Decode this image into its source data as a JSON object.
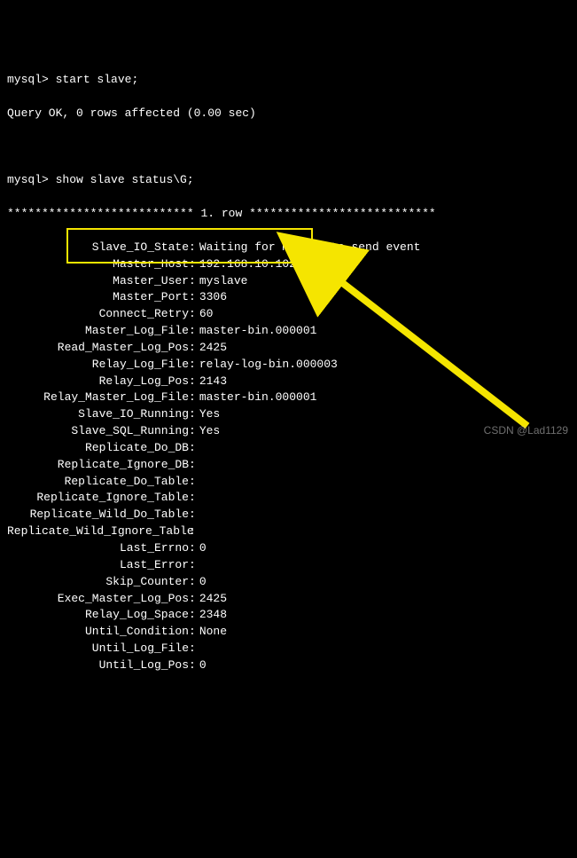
{
  "prompt": "mysql>",
  "cmd1": "start slave;",
  "resp1": "Query OK, 0 rows affected (0.00 sec)",
  "cmd2": "show slave status\\G;",
  "divider_left": "***************************",
  "divider_mid": " 1. row ",
  "divider_right": "***************************",
  "colon": ":",
  "fields": [
    {
      "label": "Slave_IO_State",
      "value": "Waiting for master to send event"
    },
    {
      "label": "Master_Host",
      "value": "192.168.10.102"
    },
    {
      "label": "Master_User",
      "value": "myslave"
    },
    {
      "label": "Master_Port",
      "value": "3306"
    },
    {
      "label": "Connect_Retry",
      "value": "60"
    },
    {
      "label": "Master_Log_File",
      "value": "master-bin.000001"
    },
    {
      "label": "Read_Master_Log_Pos",
      "value": "2425"
    },
    {
      "label": "Relay_Log_File",
      "value": "relay-log-bin.000003"
    },
    {
      "label": "Relay_Log_Pos",
      "value": "2143"
    },
    {
      "label": "Relay_Master_Log_File",
      "value": "master-bin.000001"
    },
    {
      "label": "Slave_IO_Running",
      "value": "Yes"
    },
    {
      "label": "Slave_SQL_Running",
      "value": "Yes"
    },
    {
      "label": "Replicate_Do_DB",
      "value": ""
    },
    {
      "label": "Replicate_Ignore_DB",
      "value": ""
    },
    {
      "label": "Replicate_Do_Table",
      "value": ""
    },
    {
      "label": "Replicate_Ignore_Table",
      "value": ""
    },
    {
      "label": "Replicate_Wild_Do_Table",
      "value": ""
    },
    {
      "label": "Replicate_Wild_Ignore_Table",
      "value": ""
    },
    {
      "label": "Last_Errno",
      "value": "0"
    },
    {
      "label": "Last_Error",
      "value": ""
    },
    {
      "label": "Skip_Counter",
      "value": "0"
    },
    {
      "label": "Exec_Master_Log_Pos",
      "value": "2425"
    },
    {
      "label": "Relay_Log_Space",
      "value": "2348"
    },
    {
      "label": "Until_Condition",
      "value": "None"
    },
    {
      "label": "Until_Log_File",
      "value": ""
    },
    {
      "label": "Until_Log_Pos",
      "value": "0"
    }
  ],
  "watermark": "CSDN @Lad1129"
}
